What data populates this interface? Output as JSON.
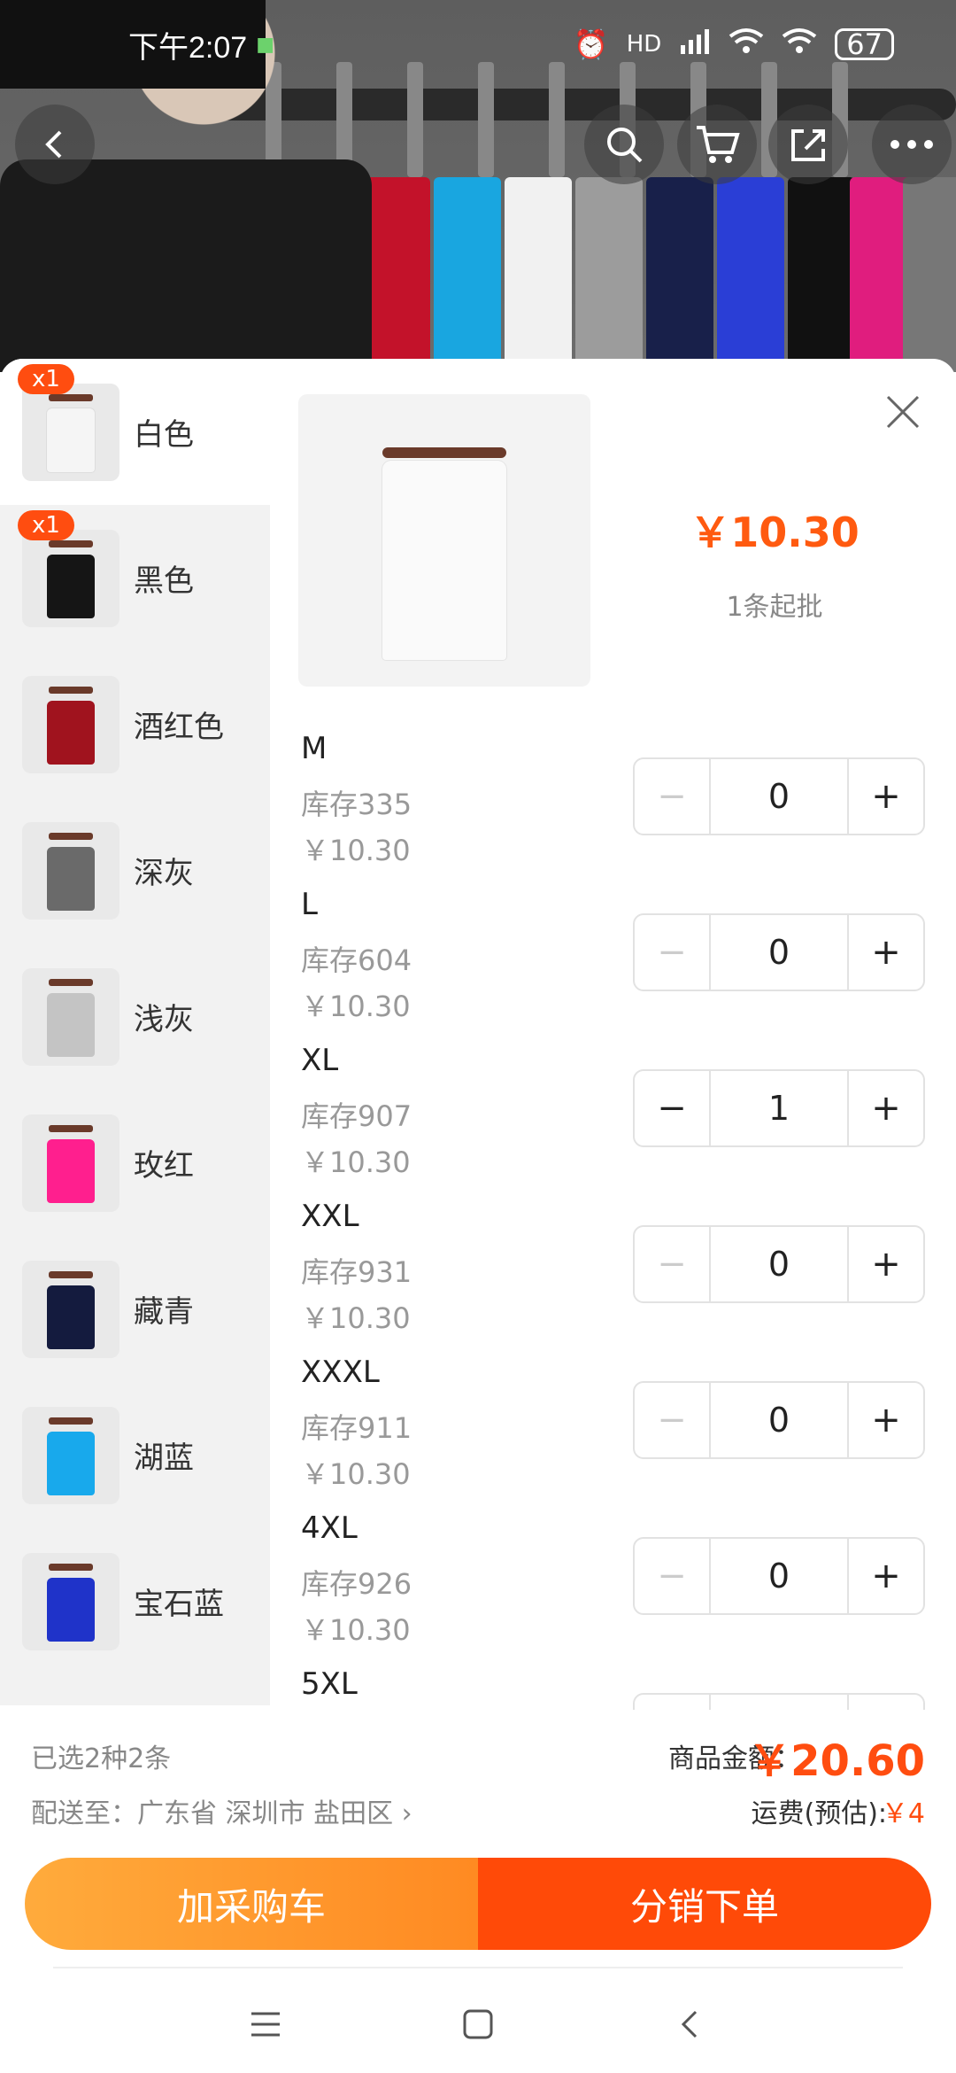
{
  "status_bar": {
    "time": "下午2:07",
    "battery": "67",
    "network": "HD"
  },
  "header": {
    "back_icon": "back-arrow-icon",
    "search_icon": "search-icon",
    "cart_icon": "cart-icon",
    "share_icon": "share-icon",
    "more_icon": "more-icon"
  },
  "colors": [
    {
      "label": "白色",
      "badge": "x1",
      "swatch": "#f5f5f5",
      "active": true
    },
    {
      "label": "黑色",
      "badge": "x1",
      "swatch": "#151515"
    },
    {
      "label": "酒红色",
      "badge": "",
      "swatch": "#a0131e"
    },
    {
      "label": "深灰",
      "badge": "",
      "swatch": "#6a6a6a"
    },
    {
      "label": "浅灰",
      "badge": "",
      "swatch": "#c4c4c4"
    },
    {
      "label": "玫红",
      "badge": "",
      "swatch": "#ff1f8e"
    },
    {
      "label": "藏青",
      "badge": "",
      "swatch": "#141b3e"
    },
    {
      "label": "湖蓝",
      "badge": "",
      "swatch": "#18a9ec"
    },
    {
      "label": "宝石蓝",
      "badge": "",
      "swatch": "#1f33c9"
    }
  ],
  "product": {
    "price": "￥10.30",
    "min_order": "1条起批"
  },
  "sizes": [
    {
      "name": "M",
      "stock": "库存335",
      "price": "￥10.30",
      "qty": "0",
      "minus": "−",
      "plus": "+"
    },
    {
      "name": "L",
      "stock": "库存604",
      "price": "￥10.30",
      "qty": "0",
      "minus": "−",
      "plus": "+"
    },
    {
      "name": "XL",
      "stock": "库存907",
      "price": "￥10.30",
      "qty": "1",
      "minus": "−",
      "plus": "+"
    },
    {
      "name": "XXL",
      "stock": "库存931",
      "price": "￥10.30",
      "qty": "0",
      "minus": "−",
      "plus": "+"
    },
    {
      "name": "XXXL",
      "stock": "库存911",
      "price": "￥10.30",
      "qty": "0",
      "minus": "−",
      "plus": "+"
    },
    {
      "name": "4XL",
      "stock": "库存926",
      "price": "￥10.30",
      "qty": "0",
      "minus": "−",
      "plus": "+"
    },
    {
      "name": "5XL",
      "stock": "",
      "price": "",
      "qty": "",
      "minus": "",
      "plus": ""
    }
  ],
  "footer": {
    "selection_summary": "已选2种2条",
    "ship_to": "配送至：广东省 深圳市 盐田区 ›",
    "amount_label": "商品金额：",
    "amount_value": "￥20.60",
    "freight_label": "运费(预估):",
    "freight_value": "￥4",
    "add_cart": "加采购车",
    "place_order": "分销下单"
  },
  "accent_color": "#ff4a08"
}
